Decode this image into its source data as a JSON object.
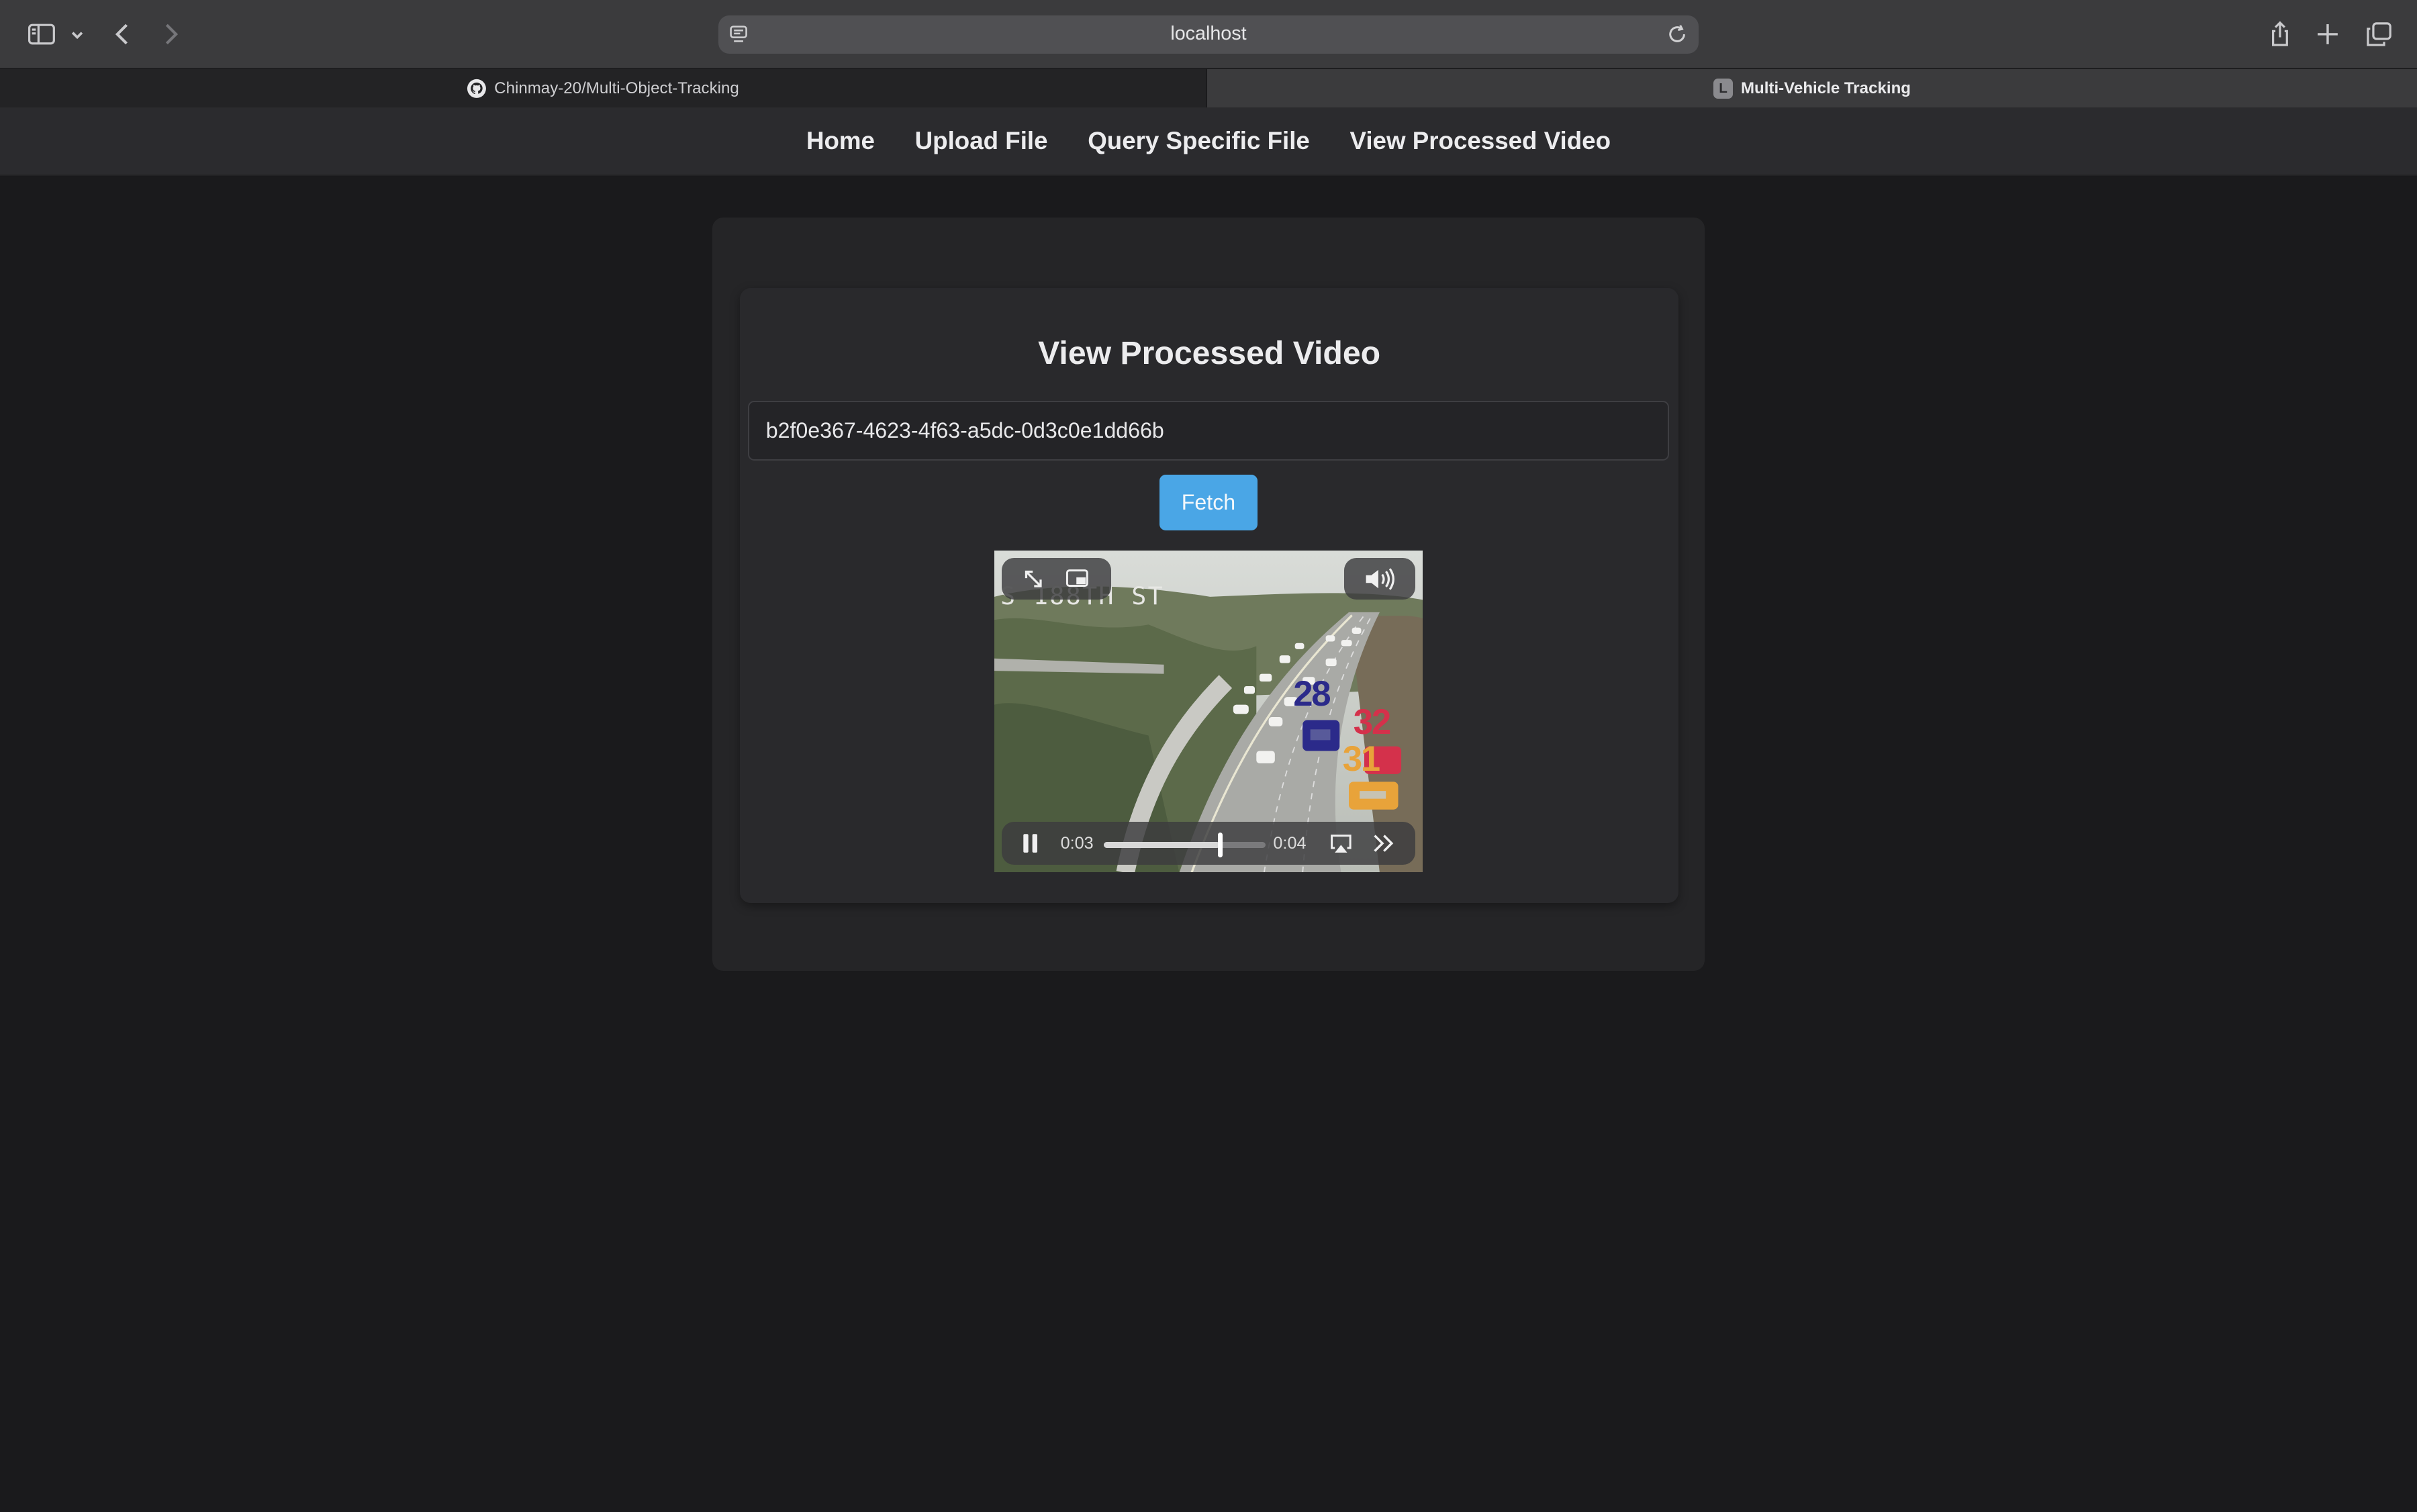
{
  "browser": {
    "url": "localhost",
    "tabs": [
      {
        "title": "Chinmay-20/Multi-Object-Tracking",
        "favicon": "github-icon",
        "active": false
      },
      {
        "title": "Multi-Vehicle Tracking",
        "favicon_letter": "L",
        "active": true
      }
    ]
  },
  "nav": {
    "items": [
      "Home",
      "Upload File",
      "Query Specific File",
      "View Processed Video"
    ]
  },
  "page": {
    "title": "View Processed Video",
    "file_id_value": "b2f0e367-4623-4f63-a5dc-0d3c0e1dd66b",
    "fetch_label": "Fetch"
  },
  "video": {
    "camera_overlay_text": "S 188TH ST",
    "track_labels": [
      {
        "id": "28",
        "color": "#2b2a8a"
      },
      {
        "id": "32",
        "color": "#d4314b"
      },
      {
        "id": "31",
        "color": "#e8a33a"
      }
    ],
    "current_time": "0:03",
    "duration": "0:04",
    "progress": 0.72,
    "state": "playing"
  },
  "colors": {
    "accent": "#4aa6e6",
    "background": "#1a1a1c"
  }
}
